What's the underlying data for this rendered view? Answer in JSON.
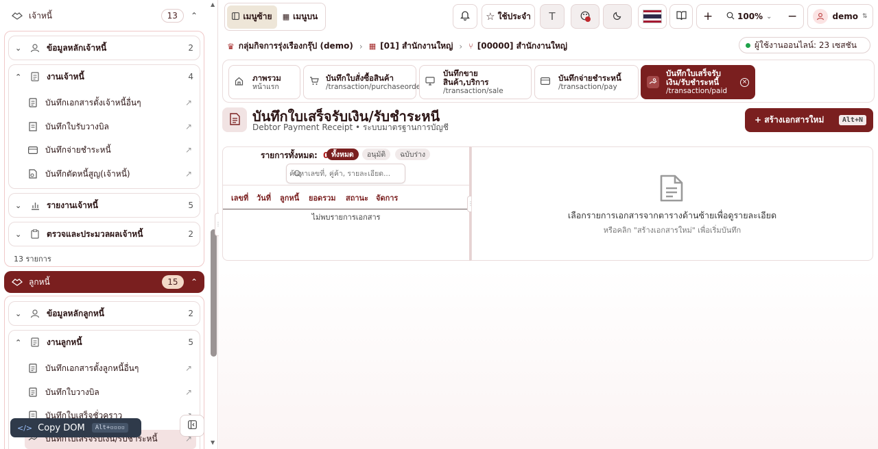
{
  "sidebar": {
    "creditor_group": {
      "label": "เจ้าหนี้",
      "count": "13"
    },
    "creditor_master": {
      "label": "ข้อมูลหลักเจ้าหนี้",
      "count": "2"
    },
    "creditor_work": {
      "label": "งานเจ้าหนี้",
      "count": "4",
      "items": [
        "บันทึกเอกสารตั้งเจ้าหนี้อื่นๆ",
        "บันทึกใบรับวางบิล",
        "บันทึกจ่ายชำระหนี้",
        "บันทึกตัดหนี้สูญ(เจ้าหนี้)"
      ]
    },
    "creditor_report": {
      "label": "รายงานเจ้าหนี้",
      "count": "5"
    },
    "creditor_process": {
      "label": "ตรวจและประมวลผลเจ้าหนี้",
      "count": "2"
    },
    "creditor_total": "13 รายการ",
    "debtor_group": {
      "label": "ลูกหนี้",
      "count": "15"
    },
    "debtor_master": {
      "label": "ข้อมูลหลักลูกหนี้",
      "count": "2"
    },
    "debtor_work": {
      "label": "งานลูกหนี้",
      "count": "5",
      "items": [
        "บันทึกเอกสารตั้งลูกหนี้อื่นๆ",
        "บันทึกใบวางบิล",
        "บันทึกใบเสร็จชั่วคราว",
        "บันทึกใบเสร็จรับเงิน/รับชำระหนี้"
      ]
    },
    "copy_dom": {
      "label": "Copy DOM",
      "shortcut": "Alt+▫▫▫▫"
    }
  },
  "topbar": {
    "menu_left": "เมนูซ้าย",
    "menu_top": "เมนูบน",
    "favorites": "ใช้ประจำ",
    "font_label": "T",
    "zoom": "100%",
    "user": "demo",
    "online": "ผู้ใช้งานออนไลน์: 23 เซสชัน"
  },
  "breadcrumb": {
    "company": "กลุ่มกิจการรุ่งเรืองกรุ๊ป (demo)",
    "branch": "[01] สำนักงานใหญ่",
    "office": "[00000] สำนักงานใหญ่"
  },
  "tabs": [
    {
      "title": "ภาพรวม",
      "path": "หน้าแรก"
    },
    {
      "title": "บันทึกใบสั่งซื้อสินค้า",
      "path": "/transaction/purchaseorder"
    },
    {
      "title": "บันทึกขาย",
      "title2": "สินค้า,บริการ",
      "path": "/transaction/sale"
    },
    {
      "title": "บันทึกจ่ายชำระหนี้",
      "path": "/transaction/pay"
    },
    {
      "title": "บันทึกใบเสร็จรับ",
      "title2": "เงิน/รับชำระหนี้",
      "path": "/transaction/paid"
    }
  ],
  "page": {
    "title": "บันทึกใบเสร็จรับเงิน/รับชำระหนี",
    "subtitle": "Debtor Payment Receipt • ระบบมาตรฐานการบัญชี",
    "create_button": "+ สร้างเอกสารใหม่",
    "create_shortcut": "Alt+N"
  },
  "list": {
    "total_label": "รายการทั้งหมด:",
    "total_value": "0",
    "filters": [
      "ทั้งหมด",
      "อนุมัติ",
      "ฉบับร่าง"
    ],
    "search_placeholder": "ค้นหาเลขที่, คู่ค้า, รายละเอียด...",
    "columns": [
      "เลขที่",
      "วันที่",
      "ลูกหนี้",
      "ยอดรวม",
      "สถานะ",
      "จัดการ"
    ],
    "empty": "ไม่พบรายการเอกสาร"
  },
  "detail": {
    "empty_title": "เลือกรายการเอกสารจากตารางด้านซ้ายเพื่อดูรายละเอียด",
    "empty_hint": "หรือคลิก \"สร้างเอกสารใหม่\" เพื่อเริ่มบันทึก"
  },
  "colors": {
    "accent": "#7a1f1f",
    "online_dot": "#1fa34a"
  }
}
